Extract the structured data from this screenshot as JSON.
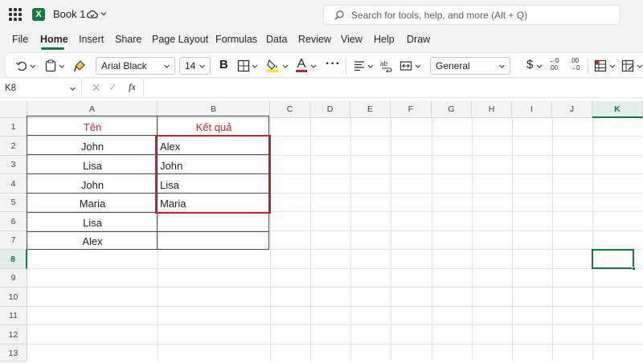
{
  "titlebar": {
    "doc_title": "Book 1",
    "search_placeholder": "Search for tools, help, and more (Alt + Q)",
    "logo_letter": "X",
    "accent": "#107c41"
  },
  "menu": {
    "tabs": [
      "File",
      "Home",
      "Insert",
      "Share",
      "Page Layout",
      "Formulas",
      "Data",
      "Review",
      "View",
      "Help",
      "Draw"
    ],
    "active": "Home"
  },
  "ribbon": {
    "font_name": "Arial Black",
    "font_size": "14",
    "bold_label": "B",
    "number_format": "General",
    "currency_symbol": "$",
    "more_label": "···",
    "dec_increase_top": "←0",
    "dec_increase_bottom": ".00",
    "dec_decrease_top": ".00",
    "dec_decrease_bottom": "→0",
    "font_color_bar": "#c0282d",
    "fill_color_bar": "#ffe600"
  },
  "formula_bar": {
    "name_box": "K8",
    "fx_label": "fx",
    "cancel_symbol": "✕",
    "enter_symbol": "✓",
    "formula": ""
  },
  "sheet": {
    "columns": [
      "A",
      "B",
      "C",
      "D",
      "E",
      "F",
      "G",
      "H",
      "I",
      "J",
      "K"
    ],
    "rows": [
      "1",
      "2",
      "3",
      "4",
      "5",
      "6",
      "7",
      "8",
      "9",
      "10",
      "11",
      "12",
      "13"
    ],
    "selected_column": "K",
    "selected_row": "8",
    "header_color": "#c0282d",
    "cells": {
      "A1": "Tên",
      "B1": "Kết quả",
      "A2": "John",
      "B2": "Alex",
      "A3": "Lisa",
      "B3": "John",
      "A4": "John",
      "B4": "Lisa",
      "A5": "Maria",
      "B5": "Maria",
      "A6": "Lisa",
      "A7": "Alex"
    }
  }
}
